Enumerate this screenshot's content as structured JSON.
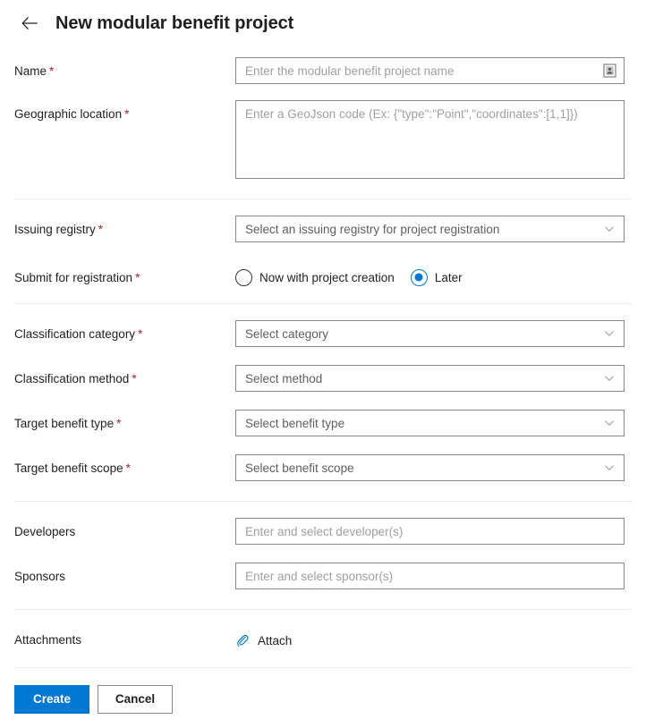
{
  "header": {
    "back_icon": "arrow-left-icon",
    "title": "New modular benefit project"
  },
  "form": {
    "name": {
      "label": "Name",
      "required": "*",
      "placeholder": "Enter the modular benefit project name",
      "value": "",
      "icon": "id-badge-icon"
    },
    "geographic_location": {
      "label": "Geographic location",
      "required": "*",
      "placeholder": "Enter a GeoJson code (Ex: {\"type\":\"Point\",\"coordinates\":[1,1]})",
      "value": ""
    },
    "issuing_registry": {
      "label": "Issuing registry",
      "required": "*",
      "selected": "Select an issuing registry for project registration",
      "chevron": "chevron-down-icon"
    },
    "submit_for_registration": {
      "label": "Submit for registration",
      "required": "*",
      "options": [
        {
          "label": "Now with project creation",
          "selected": false
        },
        {
          "label": "Later",
          "selected": true
        }
      ]
    },
    "classification_category": {
      "label": "Classification category",
      "required": "*",
      "selected": "Select category",
      "chevron": "chevron-down-icon"
    },
    "classification_method": {
      "label": "Classification method",
      "required": "*",
      "selected": "Select method",
      "chevron": "chevron-down-icon"
    },
    "target_benefit_type": {
      "label": "Target benefit type",
      "required": "*",
      "selected": "Select benefit type",
      "chevron": "chevron-down-icon"
    },
    "target_benefit_scope": {
      "label": "Target benefit scope",
      "required": "*",
      "selected": "Select benefit scope",
      "chevron": "chevron-down-icon"
    },
    "developers": {
      "label": "Developers",
      "placeholder": "Enter and select developer(s)",
      "value": ""
    },
    "sponsors": {
      "label": "Sponsors",
      "placeholder": "Enter and select sponsor(s)",
      "value": ""
    },
    "attachments": {
      "label": "Attachments",
      "action_label": "Attach",
      "icon": "paperclip-icon"
    }
  },
  "footer": {
    "create_label": "Create",
    "cancel_label": "Cancel"
  },
  "colors": {
    "accent": "#0078d4",
    "required_asterisk": "#a4262c",
    "border": "#8a8886",
    "divider": "#edebe9",
    "placeholder": "#a19f9d",
    "text": "#201f1e"
  }
}
